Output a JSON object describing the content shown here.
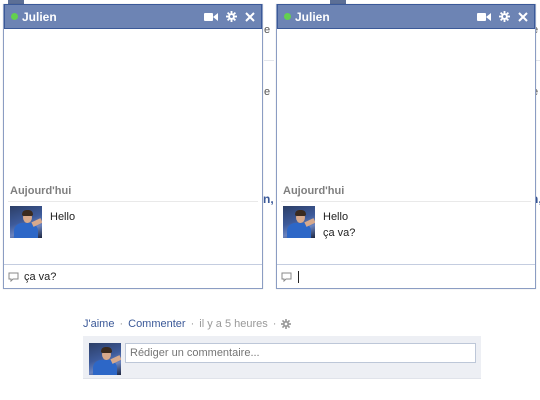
{
  "background_page": {
    "fragments": [
      "e",
      "e",
      "n,",
      "e"
    ]
  },
  "chat_windows": [
    {
      "name": "Julien",
      "day_label": "Aujourd'hui",
      "messages": [
        "Hello"
      ],
      "input_value": "ça  va?",
      "icons": [
        "video-call-icon",
        "gear-icon",
        "close-icon"
      ]
    },
    {
      "name": "Julien",
      "day_label": "Aujourd'hui",
      "messages": [
        "Hello",
        "ça  va?"
      ],
      "input_value": "",
      "icons": [
        "video-call-icon",
        "gear-icon",
        "close-icon"
      ]
    }
  ],
  "post_actions": {
    "like": "J'aime",
    "comment": "Commenter",
    "separator": "·",
    "timestamp": "il y a 5 heures"
  },
  "comment_box": {
    "placeholder": "Rédiger un commentaire..."
  },
  "colors": {
    "header_bg": "#6d84b4",
    "header_border": "#3b5998",
    "online_dot": "#63d04e",
    "link": "#3b5998"
  }
}
